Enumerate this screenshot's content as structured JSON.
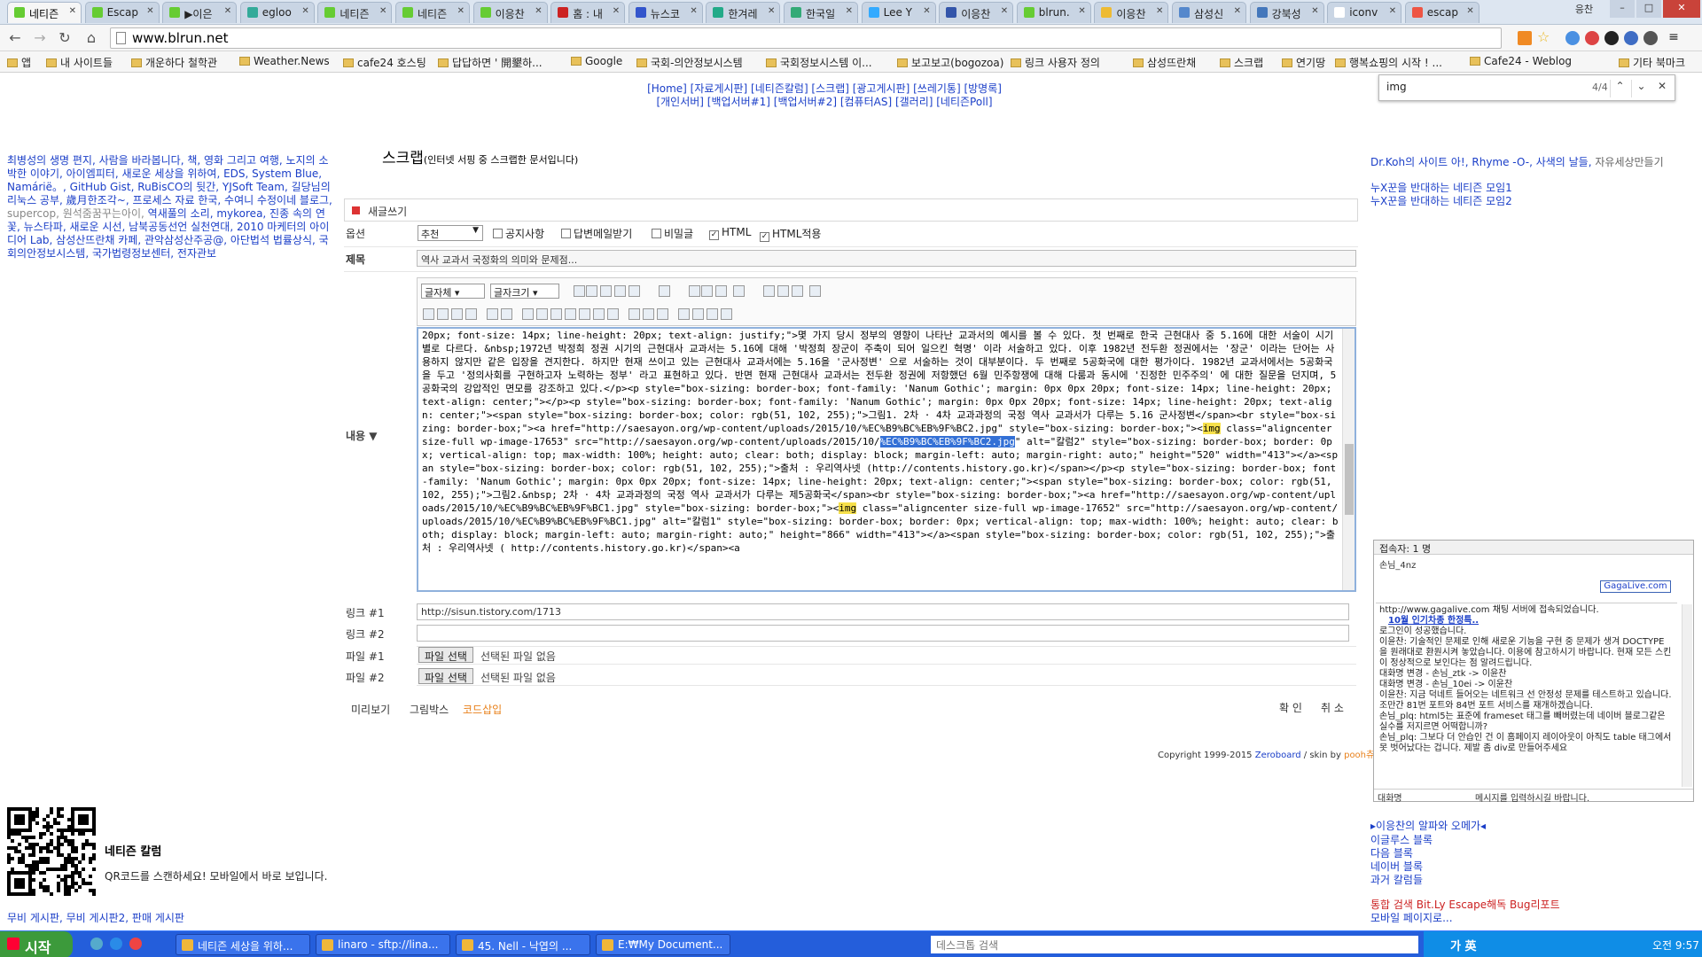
{
  "tabs": [
    "네티즌",
    "Escap",
    "▶이은",
    "egloo",
    "네티즌",
    "네티즌",
    "이응찬",
    "홈 : 내",
    "뉴스코",
    "한겨레",
    "한국일",
    "Lee Y",
    "이응찬",
    "blrun.",
    "이응찬",
    "삼성신",
    "강북성",
    "iconv",
    "escap"
  ],
  "window": {
    "user": "응찬",
    "min": "–",
    "max": "□",
    "close": "✕"
  },
  "url": "www.blrun.net",
  "bookmarks": [
    "앱",
    "내 사이트들",
    "개운하다 철학관",
    "Weather.News",
    "cafe24 호스팅",
    "답답하면 ' 開墾하...",
    "Google",
    "국회-의안정보시스템",
    "국회정보시스템 이...",
    "보고보고(bogozoa)",
    "링크 사용자 정의",
    "삼성뜨란채",
    "스크랩",
    "연기땅",
    "행복쇼핑의 시작 ! ...",
    "Cafe24 - Weblog",
    "기타 북마크"
  ],
  "find": {
    "query": "img",
    "count": "4/4",
    "up": "⌃",
    "down": "⌄",
    "close": "✕"
  },
  "topnav": {
    "line1": "[Home] [자료게시판] [네티즌칼럼] [스크랩] [광고게시판] [쓰레기통] [방명록]",
    "line2": "[개인서버] [백업서버#1] [백업서버#2] [컴퓨터AS] [갤러리] [네티즌Poll]"
  },
  "left_links": {
    "main": "최병성의 생명 편지, 사람을 바라봅니다, 책, 영화 그리고 여행, 노지의 소박한 이야기, 아이엠피터, 새로운 세상을 위하여, EDS, System Blue, Namárië。, GitHub Gist, RuBisCO의 뒷간, YJSoft Team, 길당님의 리눅스 공부, 歲月한조각~, 프로세스 자료 한국, 수여니 수정이네 블로그, ",
    "gray": "supercop, 원석줌꿈꾸는아이,",
    "main2": " 역새풀의 소리, mykorea, 진종 속의 연꽃, 뉴스타파, 새로운 시선, 남북공동선언 실천연대, 2010 마케터의 아이디어 Lab, 삼성산뜨란채 카페, 관악삼성산주공@, 아단법석 법률상식, 국회의안정보시스템, 국가법령정보센터, 전자관보"
  },
  "right_top": {
    "line1": "Dr.Koh의 사이트 아!, Rhyme -O-, 사색의 날들, ",
    "gray": "자유세상만들기",
    "b1": "누X꾼을 반대하는 네티즌 모임1",
    "b2": "누X꾼을 반대하는 네티즌 모임2"
  },
  "page": {
    "title": "스크랩",
    "subtitle": "(인터넷 서핑 중 스크랩한 문서입니다)",
    "write": "새글쓰기"
  },
  "form": {
    "options_label": "옵션",
    "select": "추천",
    "checks": [
      {
        "label": "공지사항",
        "on": false
      },
      {
        "label": "답변메일받기",
        "on": false
      },
      {
        "label": "비밀글",
        "on": false
      },
      {
        "label": "HTML",
        "on": true
      },
      {
        "label": "HTML적용",
        "on": true
      }
    ],
    "subject_label": "제목",
    "subject": "역사 교과서 국정화의 의미와 문제점...",
    "content_label": "내용 ▼",
    "font_sel": "글자체",
    "size_sel": "글자크기",
    "link1_label": "링크 #1",
    "link1": "http://sisun.tistory.com/1713",
    "link2_label": "링크 #2",
    "link2": "",
    "file1_label": "파일 #1",
    "file2_label": "파일 #2",
    "file_btn": "파일 선택",
    "file_none": "선택된 파일 없음",
    "preview": "미리보기",
    "gridbox": "그림박스",
    "codeinsert": "코드삽입",
    "ok": "확  인",
    "cancel": "취  소"
  },
  "editor": {
    "before": "20px; font-size: 14px; line-height: 20px; text-align: justify;\">몇 가지 당시 정부의 영향이 나타난 교과서의 예시를 볼 수 있다. 첫 번째로 한국 근현대사 중 5.16에 대한 서술이 시기별로 다르다. &nbsp;1972년 박정희 정권 시기의 근현대사 교과서는 5.16에 대해 '박정희 장군이 주축이 되어 일으킨 혁명' 이라 서술하고 있다. 이후 1982년 전두환 정권에서는 '장군' 이라는 단어는 사용하지 않지만 같은 입장을 견지한다. 하지만 현재 쓰이고 있는 근현대사 교과서에는 5.16을 '군사정변' 으로 서술하는 것이 대부분이다. 두 번째로 5공화국에 대한 평가이다. 1982년 교과서에서는 5공화국을 두고 '정의사회를 구현하고자 노력하는 정부' 라고 표현하고 있다. 반면 현재 근현대사 교과서는 전두환 정권에 저항했던 6월 민주항쟁에 대해 다룸과 동시에 '진정한 민주주의' 에 대한 질문을 던지며, 5공화국의 강압적인 면모를 강조하고 있다.</p><p style=\"box-sizing: border-box; font-family: 'Nanum Gothic'; margin: 0px 0px 20px; font-size: 14px; line-height: 20px; text-align: center;\"></p><p style=\"box-sizing: border-box; font-family: 'Nanum Gothic'; margin: 0px 0px 20px; font-size: 14px; line-height: 20px; text-align: center;\"><span style=\"box-sizing: border-box; color: rgb(51, 102, 255);\">그림1. 2차 · 4차 교과과정의 국정 역사 교과서가 다루는 5.16 군사정변</span><br style=\"box-sizing: border-box;\"><a href=\"http://saesayon.org/wp-content/uploads/2015/10/%EC%B9%BC%EB%9F%BC2.jpg\" style=\"box-sizing: border-box;\"><",
    "mark1": "img",
    "mid1": " class=\"aligncenter size-full wp-image-17653\" src=\"http://saesayon.org/wp-content/uploads/2015/10/",
    "hl": "%EC%B9%BC%EB%9F%BC2.jpg",
    "after": "\" alt=\"칼럼2\" style=\"box-sizing: border-box; border: 0px; vertical-align: top; max-width: 100%; height: auto; clear: both; display: block; margin-left: auto; margin-right: auto;\" height=\"520\" width=\"413\"></a><span style=\"box-sizing: border-box; color: rgb(51, 102, 255);\">출처 : 우리역사넷 (http://contents.history.go.kr)</span></p><p style=\"box-sizing: border-box; font-family: 'Nanum Gothic'; margin: 0px 0px 20px; font-size: 14px; line-height: 20px; text-align: center;\"><span style=\"box-sizing: border-box; color: rgb(51, 102, 255);\">그림2.&nbsp; 2차 · 4차 교과과정의 국정 역사 교과서가 다루는 제5공화국</span><br style=\"box-sizing: border-box;\"><a href=\"http://saesayon.org/wp-content/uploads/2015/10/%EC%B9%BC%EB%9F%BC1.jpg\" style=\"box-sizing: border-box;\"><",
    "mark2": "img",
    "tail": " class=\"aligncenter size-full wp-image-17652\" src=\"http://saesayon.org/wp-content/uploads/2015/10/%EC%B9%BC%EB%9F%BC1.jpg\" alt=\"칼럼1\" style=\"box-sizing: border-box; border: 0px; vertical-align: top; max-width: 100%; height: auto; clear: both; display: block; margin-left: auto; margin-right: auto;\" height=\"866\" width=\"413\"></a><span style=\"box-sizing: border-box; color: rgb(51, 102, 255);\">출처 : 우리역사넷 ( http://contents.history.go.kr)</span><a"
  },
  "copyright": {
    "text": "Copyright 1999-2015 ",
    "zb": "Zeroboard",
    "skin": " / skin by ",
    "pooh": "pooh츄"
  },
  "chat": {
    "header": "접속자: 1 명",
    "nick": "손님_4nz",
    "brand": "GagaLive.com",
    "log": [
      "http://www.gagalive.com 채팅 서버에 접속되었습니다.",
      "10월 인기차종 한정특..",
      "로그인이 성공했습니다.",
      "이윤찬: 기술적인 문제로 인해 새로운 기능을 구현 중 문제가 생겨 DOCTYPE 을 원래대로 환원시켜 놓았습니다. 이용에 참고하시기 바랍니다. 현재 모든 스킨이 정상적으로 보인다는 점 알려드립니다.",
      "대화명 변경 - 손님_ztk -> 이윤찬",
      "대화명 변경 - 손님_10ei -> 이윤찬",
      "이윤찬: 지금 덕네트 들어오는 네트워크 선 안정성 문제를 테스트하고 있습니다. 조만간 81번 포트와 84번 포트 서비스를 재개하겠습니다.",
      "손님_plq: html5는 표준에 frameset 태그를 빼버렸는데 네이버 블로그같은 실수를 저지르면 어떡합니까?",
      "손님_plq: 그보다 더 안습인 건 이 홈페이지 레이아웃이 아직도 table 태그에서 못 벗어났다는 겁니다. 제발 좀 div로 만들어주세요"
    ],
    "input_label": "대화명",
    "input_ph": "메시지를 입력하시길 바랍니다."
  },
  "right_bottom": {
    "l1": "▸이응찬의 알파와 오메가◂",
    "l2": "이글루스 블록",
    "l3": "다음 블록",
    "l4": "네이버 블록",
    "l5": "과거 칼럼들",
    "l6": "통합 검색 Bit.Ly Escape해독 Bug리포트",
    "l7": "모바일 페이지로..."
  },
  "qr": {
    "title": "네티즌 칼럼",
    "desc": "QR코드를 스캔하세요! 모바일에서 바로 보입니다.",
    "links": "무비 게시판, 무비 게시판2, 판매 게시판"
  },
  "taskbar": {
    "start": "시작",
    "tasks": [
      "네티즌 세상을 위하...",
      "linaro - sftp://lina...",
      "45. Nell - 낙엽의 ...",
      "E:₩My Document..."
    ],
    "search_ph": "데스크톱 검색",
    "ime": "가 英",
    "clock": "오전 9:57"
  }
}
